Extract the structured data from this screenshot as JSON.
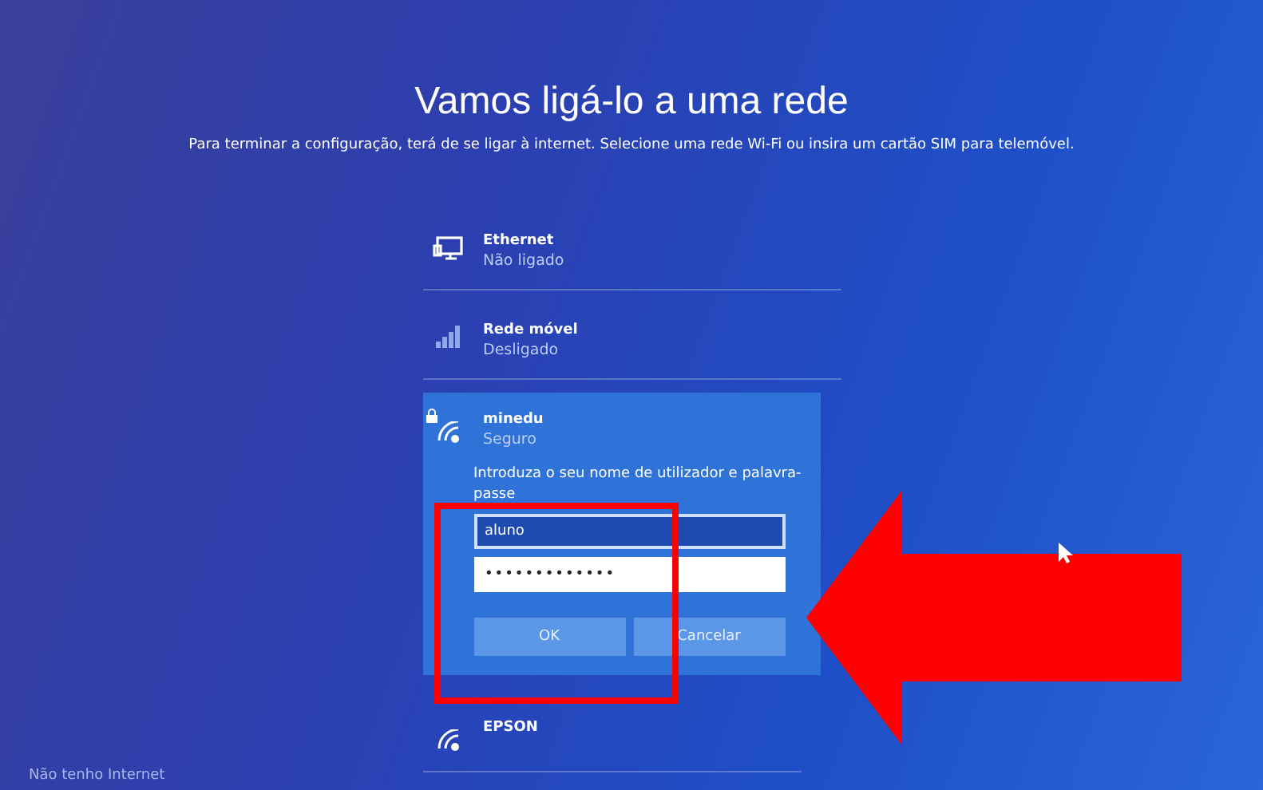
{
  "title": "Vamos ligá-lo a uma rede",
  "subtitle": "Para terminar a configuração, terá de se ligar à internet. Selecione uma rede Wi-Fi ou insira um cartão SIM para telemóvel.",
  "networks": [
    {
      "kind": "ethernet",
      "name": "Ethernet",
      "status": "Não ligado",
      "selected": false
    },
    {
      "kind": "cellular",
      "name": "Rede móvel",
      "status": "Desligado",
      "selected": false
    },
    {
      "kind": "wifi",
      "name": "minedu",
      "status": "Seguro",
      "locked": true,
      "selected": true,
      "prompt": "Introduza o seu nome de utilizador e palavra-passe",
      "username": "aluno",
      "password": "•••••••••••••",
      "buttons": [
        "OK",
        "Cancelar"
      ]
    },
    {
      "kind": "wifi",
      "name": "EPSON",
      "locked": false,
      "selected": false
    }
  ],
  "footer_link": "Não tenho Internet"
}
